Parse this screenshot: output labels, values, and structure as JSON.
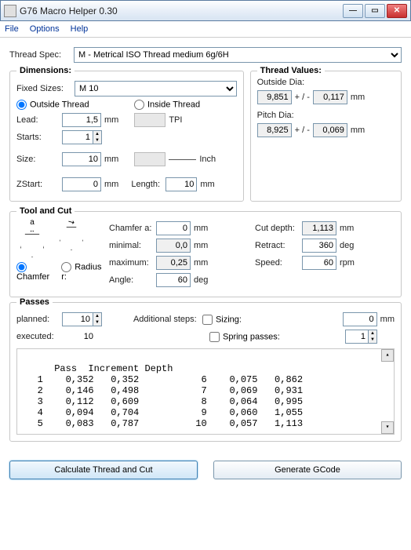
{
  "window": {
    "title": "G76 Macro Helper 0.30"
  },
  "menu": {
    "file": "File",
    "options": "Options",
    "help": "Help"
  },
  "threadSpec": {
    "label": "Thread Spec:",
    "value": "M - Metrical ISO Thread medium 6g/6H"
  },
  "dimensions": {
    "title": "Dimensions:",
    "fixedSizes": {
      "label": "Fixed Sizes:",
      "value": "M 10"
    },
    "outsideThread": "Outside Thread",
    "insideThread": "Inside Thread",
    "lead": {
      "label": "Lead:",
      "value": "1,5",
      "unit": "mm"
    },
    "tpi": "TPI",
    "starts": {
      "label": "Starts:",
      "value": "1"
    },
    "size": {
      "label": "Size:",
      "value": "10",
      "unit": "mm",
      "inch": "Inch"
    },
    "zstart": {
      "label": "ZStart:",
      "value": "0",
      "unit": "mm"
    },
    "length": {
      "label": "Length:",
      "value": "10",
      "unit": "mm"
    }
  },
  "threadValues": {
    "title": "Thread Values:",
    "outsideDia": {
      "label": "Outside Dia:",
      "value": "9,851",
      "tol": "0,117",
      "unit": "mm",
      "pm": "+ / -"
    },
    "pitchDia": {
      "label": "Pitch Dia:",
      "value": "8,925",
      "tol": "0,069",
      "unit": "mm",
      "pm": "+ / -"
    }
  },
  "toolCut": {
    "title": "Tool and Cut",
    "aLabel": "a",
    "chamfer": "Chamfer",
    "radius": "Radius r:",
    "chamferA": {
      "label": "Chamfer a:",
      "value": "0",
      "unit": "mm"
    },
    "minimal": {
      "label": "minimal:",
      "value": "0,0",
      "unit": "mm"
    },
    "maximum": {
      "label": "maximum:",
      "value": "0,25",
      "unit": "mm"
    },
    "angle": {
      "label": "Angle:",
      "value": "60",
      "unit": "deg"
    },
    "cutDepth": {
      "label": "Cut depth:",
      "value": "1,113",
      "unit": "mm"
    },
    "retract": {
      "label": "Retract:",
      "value": "360",
      "unit": "deg"
    },
    "speed": {
      "label": "Speed:",
      "value": "60",
      "unit": "rpm"
    }
  },
  "passes": {
    "title": "Passes",
    "planned": {
      "label": "planned:",
      "value": "10"
    },
    "executed": {
      "label": "executed:",
      "value": "10"
    },
    "additional": "Additional steps:",
    "sizing": {
      "label": "Sizing:",
      "value": "0",
      "unit": "mm"
    },
    "spring": {
      "label": "Spring passes:",
      "value": "1"
    },
    "table": "Pass  Increment Depth\n   1    0,352   0,352           6    0,075   0,862\n   2    0,146   0,498           7    0,069   0,931\n   3    0,112   0,609           8    0,064   0,995\n   4    0,094   0,704           9    0,060   1,055\n   5    0,083   0,787          10    0,057   1,113"
  },
  "buttons": {
    "calc": "Calculate Thread and Cut",
    "gcode": "Generate GCode"
  }
}
